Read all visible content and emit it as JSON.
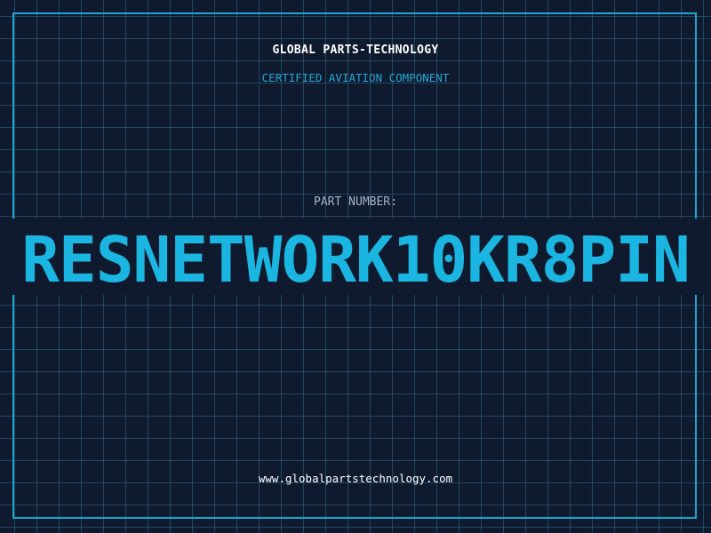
{
  "header": {
    "company": "GLOBAL PARTS-TECHNOLOGY",
    "subtitle": "CERTIFIED AVIATION COMPONENT"
  },
  "part": {
    "label": "PART NUMBER:",
    "number": "RESNETWORK10KR8PIN"
  },
  "footer": {
    "url": "www.globalpartstechnology.com"
  },
  "colors": {
    "background": "#101a2e",
    "grid": "#286e8c",
    "frame": "#1aa5cf",
    "accent": "#1ab5e0",
    "label": "#a6b3c6",
    "text": "#ffffff"
  }
}
